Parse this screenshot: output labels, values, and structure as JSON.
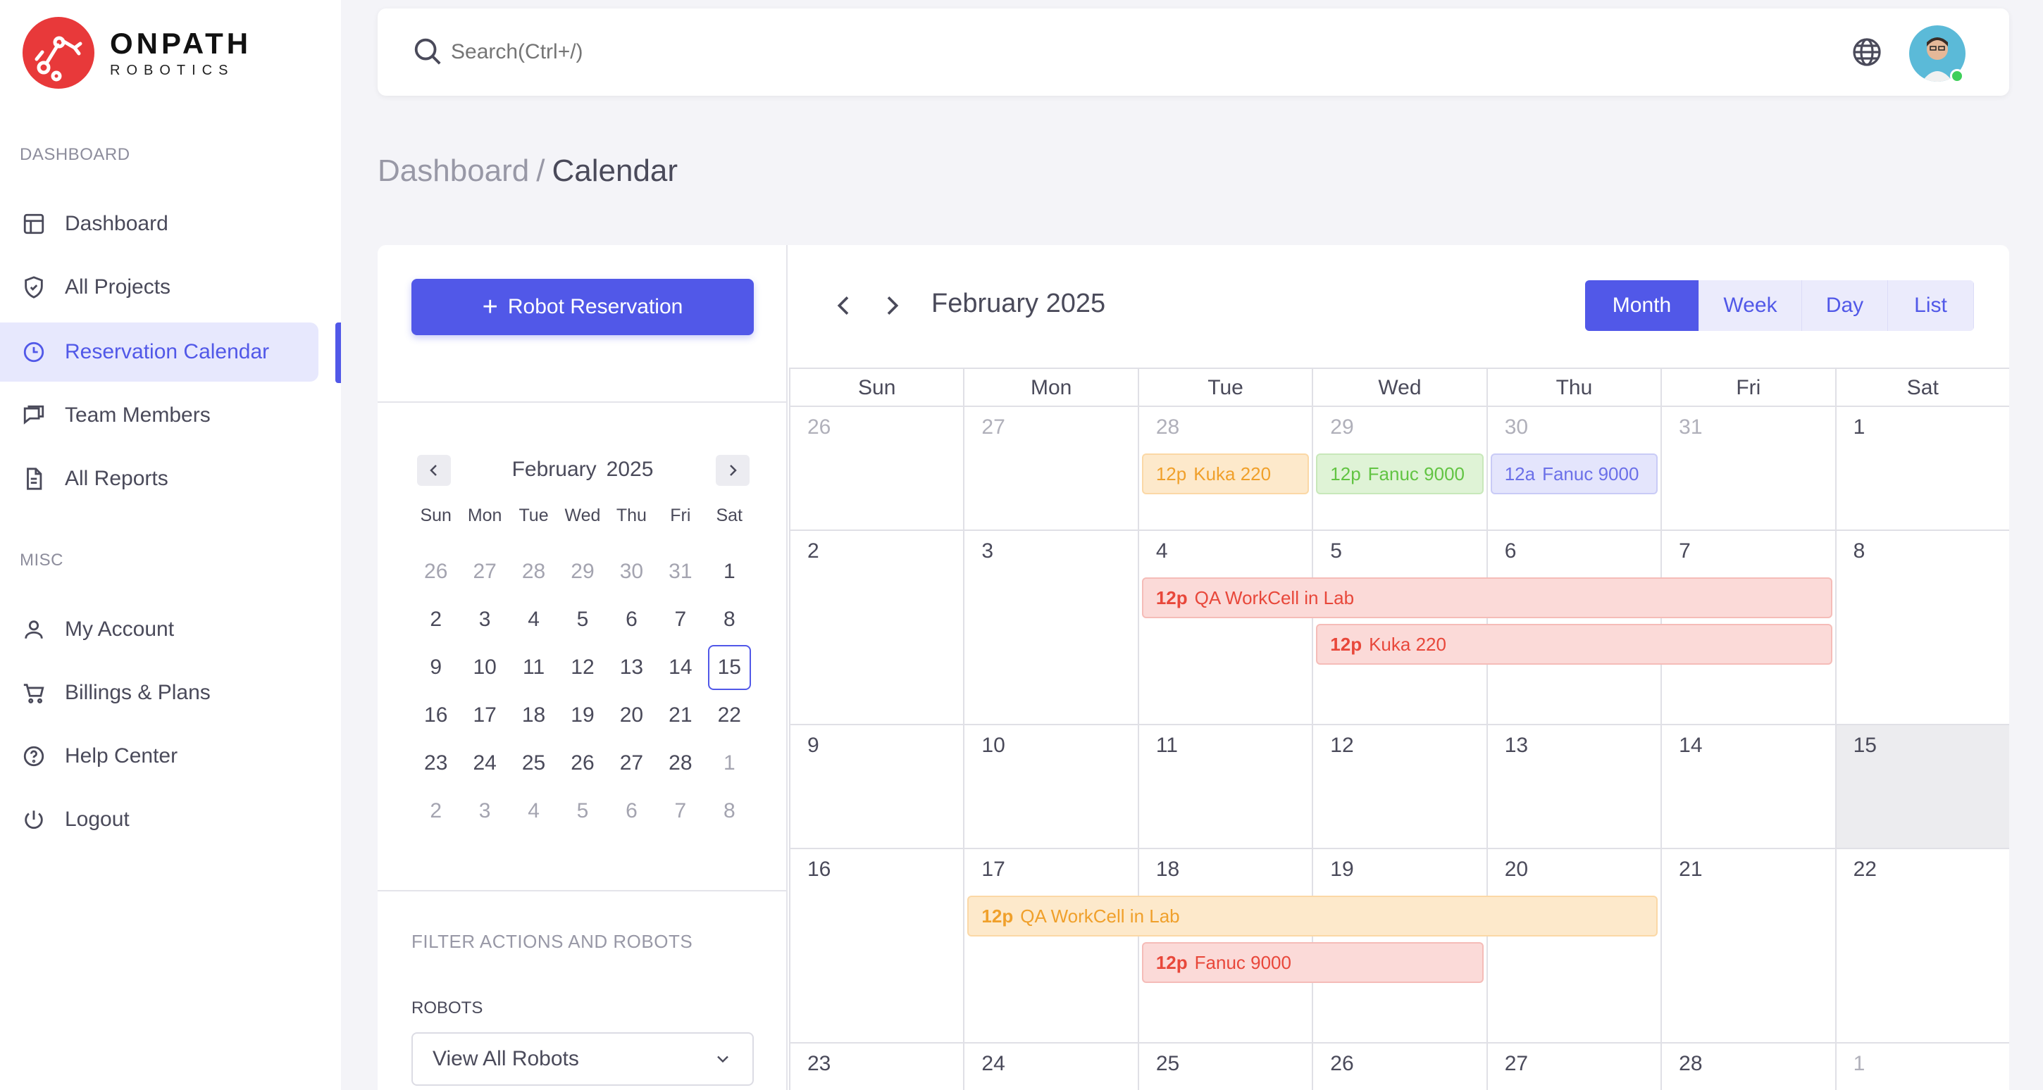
{
  "brand": {
    "name": "ONPATH",
    "sub": "ROBOTICS"
  },
  "sidebar": {
    "dashboard_section": "DASHBOARD",
    "misc_section": "MISC",
    "items": [
      {
        "label": "Dashboard",
        "icon": "layout-icon"
      },
      {
        "label": "All Projects",
        "icon": "shield-icon"
      },
      {
        "label": "Reservation Calendar",
        "icon": "clock-icon"
      },
      {
        "label": "Team Members",
        "icon": "chat-icon"
      },
      {
        "label": "All Reports",
        "icon": "file-icon"
      }
    ],
    "misc_items": [
      {
        "label": "My Account",
        "icon": "user-icon"
      },
      {
        "label": "Billings & Plans",
        "icon": "cart-icon"
      },
      {
        "label": "Help Center",
        "icon": "help-icon"
      },
      {
        "label": "Logout",
        "icon": "power-icon"
      }
    ]
  },
  "topbar": {
    "search_placeholder": "Search(Ctrl+/)"
  },
  "breadcrumb": {
    "root": "Dashboard",
    "sep": "/",
    "current": "Calendar"
  },
  "left_panel": {
    "reserve_button": "Robot Reservation",
    "mini_month": "February",
    "mini_year": "2025",
    "weekdays": [
      "Sun",
      "Mon",
      "Tue",
      "Wed",
      "Thu",
      "Fri",
      "Sat"
    ],
    "days": [
      {
        "d": "26",
        "m": true
      },
      {
        "d": "27",
        "m": true
      },
      {
        "d": "28",
        "m": true
      },
      {
        "d": "29",
        "m": true
      },
      {
        "d": "30",
        "m": true
      },
      {
        "d": "31",
        "m": true
      },
      {
        "d": "1"
      },
      {
        "d": "2"
      },
      {
        "d": "3"
      },
      {
        "d": "4"
      },
      {
        "d": "5"
      },
      {
        "d": "6"
      },
      {
        "d": "7"
      },
      {
        "d": "8"
      },
      {
        "d": "9"
      },
      {
        "d": "10"
      },
      {
        "d": "11"
      },
      {
        "d": "12"
      },
      {
        "d": "13"
      },
      {
        "d": "14"
      },
      {
        "d": "15",
        "today": true
      },
      {
        "d": "16"
      },
      {
        "d": "17"
      },
      {
        "d": "18"
      },
      {
        "d": "19"
      },
      {
        "d": "20"
      },
      {
        "d": "21"
      },
      {
        "d": "22"
      },
      {
        "d": "23"
      },
      {
        "d": "24"
      },
      {
        "d": "25"
      },
      {
        "d": "26"
      },
      {
        "d": "27"
      },
      {
        "d": "28"
      },
      {
        "d": "1",
        "m": true
      },
      {
        "d": "2",
        "m": true
      },
      {
        "d": "3",
        "m": true
      },
      {
        "d": "4",
        "m": true
      },
      {
        "d": "5",
        "m": true
      },
      {
        "d": "6",
        "m": true
      },
      {
        "d": "7",
        "m": true
      },
      {
        "d": "8",
        "m": true
      }
    ],
    "filter_label": "FILTER ACTIONS AND ROBOTS",
    "robots_label": "ROBOTS",
    "robots_select": "View All Robots"
  },
  "calendar": {
    "title": "February 2025",
    "views": [
      "Month",
      "Week",
      "Day",
      "List"
    ],
    "selected_view": "Month",
    "weekdays": [
      "Sun",
      "Mon",
      "Tue",
      "Wed",
      "Thu",
      "Fri",
      "Sat"
    ],
    "weeks": [
      [
        {
          "d": "26",
          "m": true
        },
        {
          "d": "27",
          "m": true
        },
        {
          "d": "28",
          "m": true
        },
        {
          "d": "29",
          "m": true
        },
        {
          "d": "30",
          "m": true
        },
        {
          "d": "31",
          "m": true
        },
        {
          "d": "1"
        }
      ],
      [
        {
          "d": "2"
        },
        {
          "d": "3"
        },
        {
          "d": "4"
        },
        {
          "d": "5"
        },
        {
          "d": "6"
        },
        {
          "d": "7"
        },
        {
          "d": "8"
        }
      ],
      [
        {
          "d": "9"
        },
        {
          "d": "10"
        },
        {
          "d": "11"
        },
        {
          "d": "12"
        },
        {
          "d": "13"
        },
        {
          "d": "14"
        },
        {
          "d": "15",
          "hl": true
        }
      ],
      [
        {
          "d": "16"
        },
        {
          "d": "17"
        },
        {
          "d": "18"
        },
        {
          "d": "19"
        },
        {
          "d": "20"
        },
        {
          "d": "21"
        },
        {
          "d": "22"
        }
      ],
      [
        {
          "d": "23"
        },
        {
          "d": "24"
        },
        {
          "d": "25"
        },
        {
          "d": "26"
        },
        {
          "d": "27"
        },
        {
          "d": "28"
        },
        {
          "d": "1",
          "m": true
        }
      ]
    ],
    "events": [
      {
        "time": "12p",
        "title": "Kuka 220",
        "color": "orange",
        "week": 0,
        "start": 2,
        "span": 1,
        "slot": 0,
        "bold": false
      },
      {
        "time": "12p",
        "title": "Fanuc 9000",
        "color": "green",
        "week": 0,
        "start": 3,
        "span": 1,
        "slot": 0,
        "bold": false
      },
      {
        "time": "12a",
        "title": "Fanuc 9000",
        "color": "purple",
        "week": 0,
        "start": 4,
        "span": 1,
        "slot": 0,
        "bold": false
      },
      {
        "time": "12p",
        "title": "QA WorkCell in Lab",
        "color": "red",
        "week": 1,
        "start": 2,
        "span": 4,
        "slot": 0,
        "bold": true
      },
      {
        "time": "12p",
        "title": "Kuka 220",
        "color": "red",
        "week": 1,
        "start": 3,
        "span": 3,
        "slot": 1,
        "bold": true
      },
      {
        "time": "12p",
        "title": "QA WorkCell in Lab",
        "color": "orange",
        "week": 3,
        "start": 1,
        "span": 4,
        "slot": 0,
        "bold": true
      },
      {
        "time": "12p",
        "title": "Fanuc 9000",
        "color": "red",
        "week": 3,
        "start": 2,
        "span": 2,
        "slot": 1,
        "bold": true
      }
    ]
  }
}
